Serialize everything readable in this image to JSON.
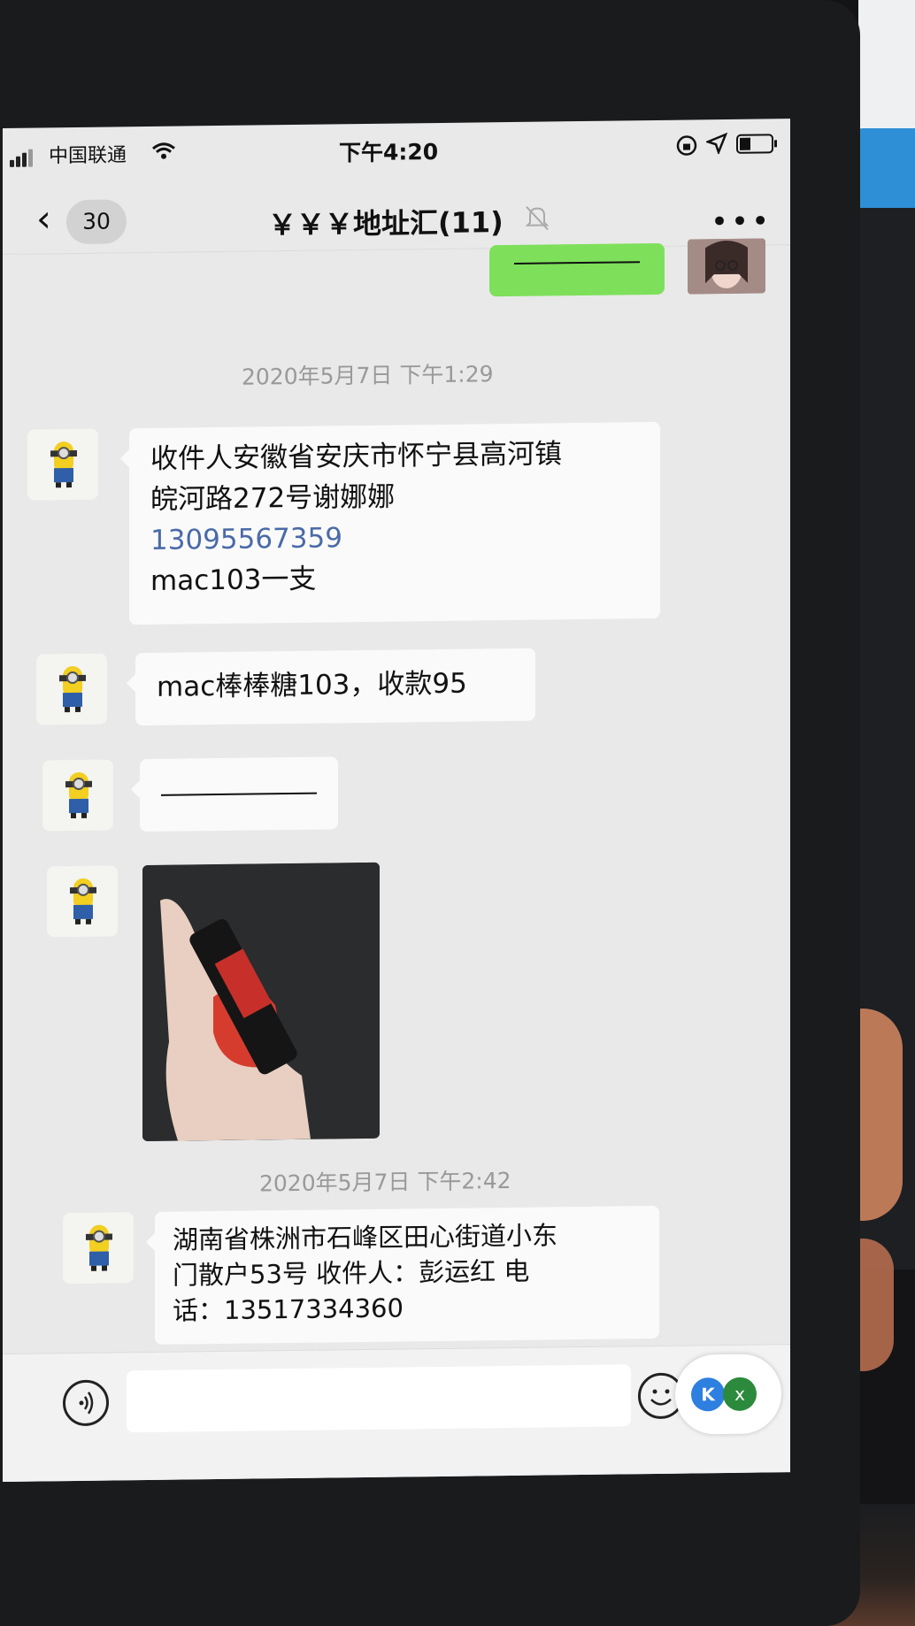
{
  "status_bar": {
    "carrier": "中国联通",
    "time": "下午4:20"
  },
  "nav": {
    "unread_count": "30",
    "title": "￥￥￥地址汇(11)"
  },
  "messages": {
    "timestamp1": "2020年5月7日 下午1:29",
    "msg1_line1": "收件人安徽省安庆市怀宁县高河镇",
    "msg1_line2": "皖河路272号谢娜娜",
    "msg1_phone": "13095567359",
    "msg1_line4": "mac103一支",
    "msg2": "mac棒棒糖103，收款95",
    "timestamp2": "2020年5月7日 下午2:42",
    "msg5_line1": "湖南省株洲市石峰区田心街道小东",
    "msg5_line2": "门散户53号  收件人：彭运红 电",
    "msg5_line3": "话：13517334360"
  },
  "colors": {
    "sent_bubble": "#7ee05a",
    "received_bubble": "#fafafa",
    "link": "#4a6aa8"
  },
  "icons": [
    "back-icon",
    "mute-icon",
    "more-icon",
    "voice-icon",
    "emoji-icon",
    "wifi-icon",
    "battery-icon"
  ]
}
